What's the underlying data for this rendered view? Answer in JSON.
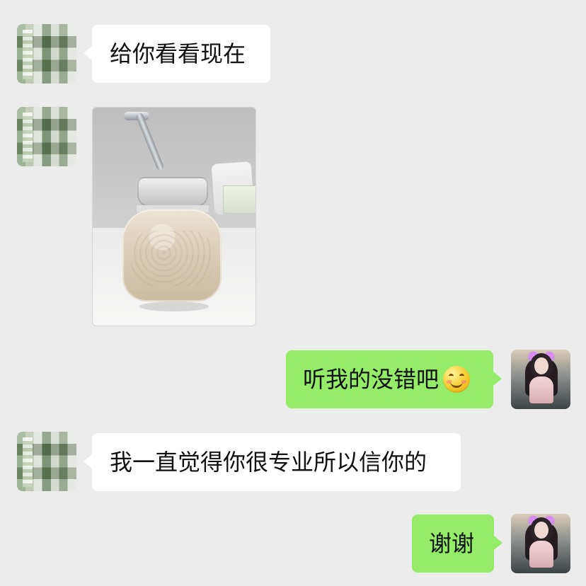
{
  "messages": [
    {
      "side": "left",
      "type": "text",
      "text": "给你看看现在"
    },
    {
      "side": "left",
      "type": "image",
      "image_alt": ""
    },
    {
      "side": "right",
      "type": "text",
      "text": "听我的没错吧",
      "emoji": "smiling-face-emoji"
    },
    {
      "side": "left",
      "type": "text",
      "text": "我一直觉得你很专业所以信你的"
    },
    {
      "side": "right",
      "type": "text",
      "text": "谢谢"
    }
  ],
  "colors": {
    "background": "#ececec",
    "incoming_bubble": "#ffffff",
    "outgoing_bubble": "#95ec69",
    "text": "#111111"
  },
  "icons": {
    "incoming_avatar": "blurred-avatar-icon",
    "outgoing_avatar": "profile-photo-avatar-icon",
    "emoji": "smiling-face-emoji"
  }
}
